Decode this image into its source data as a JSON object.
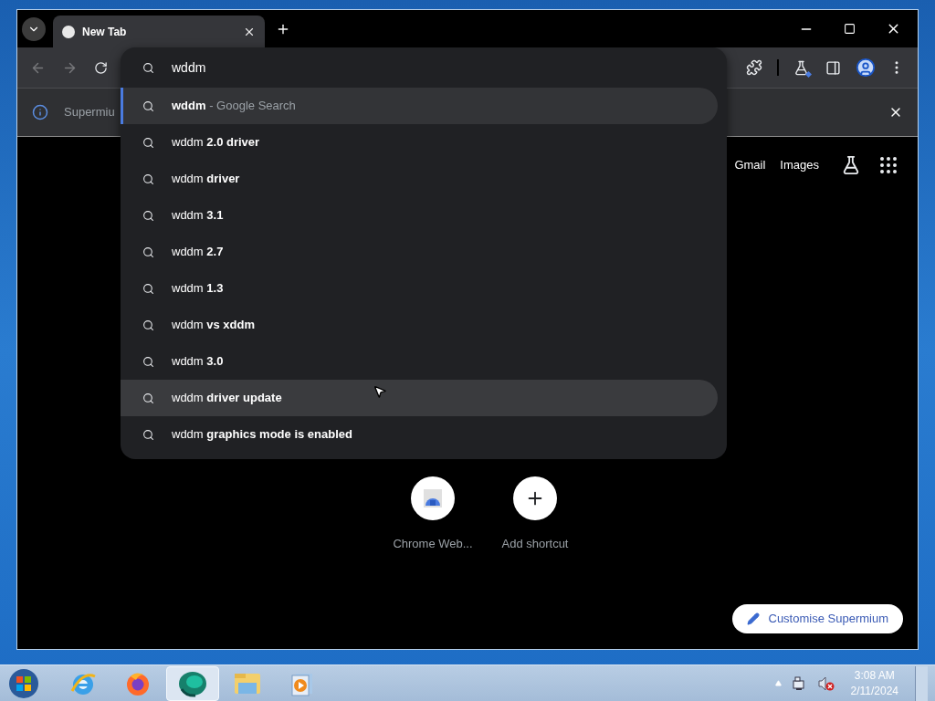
{
  "tab": {
    "title": "New Tab",
    "selected": true
  },
  "omnibox": {
    "value": "wddm"
  },
  "suggestions": [
    {
      "text": "**wddm**",
      "detail": "- Google Search",
      "selected": true,
      "hovered": false
    },
    {
      "text": "wddm **2.0 driver**",
      "selected": false,
      "hovered": false
    },
    {
      "text": "wddm **driver**",
      "selected": false,
      "hovered": false
    },
    {
      "text": "wddm **3.1**",
      "selected": false,
      "hovered": false
    },
    {
      "text": "wddm **2.7**",
      "selected": false,
      "hovered": false
    },
    {
      "text": "wddm **1.3**",
      "selected": false,
      "hovered": false
    },
    {
      "text": "wddm **vs xddm**",
      "selected": false,
      "hovered": false
    },
    {
      "text": "wddm **3.0**",
      "selected": false,
      "hovered": false
    },
    {
      "text": "wddm **driver update**",
      "selected": false,
      "hovered": true
    },
    {
      "text": "wddm **graphics mode is enabled**",
      "selected": false,
      "hovered": false
    }
  ],
  "infobar": {
    "text": "Supermiu"
  },
  "header_links": [
    "Gmail",
    "Images"
  ],
  "shortcuts": [
    {
      "label": "Chrome Web...",
      "kind": "webstore"
    },
    {
      "label": "Add shortcut",
      "kind": "add"
    }
  ],
  "customise_button": "Customise Supermium",
  "taskbar": {
    "apps": [
      {
        "kind": "ie",
        "selected": false
      },
      {
        "kind": "firefox",
        "selected": false
      },
      {
        "kind": "supermium",
        "selected": true
      },
      {
        "kind": "explorer",
        "selected": false
      },
      {
        "kind": "mediaplayer",
        "selected": false
      }
    ]
  },
  "clock": {
    "time": "3:08 AM",
    "date": "2/11/2024"
  }
}
